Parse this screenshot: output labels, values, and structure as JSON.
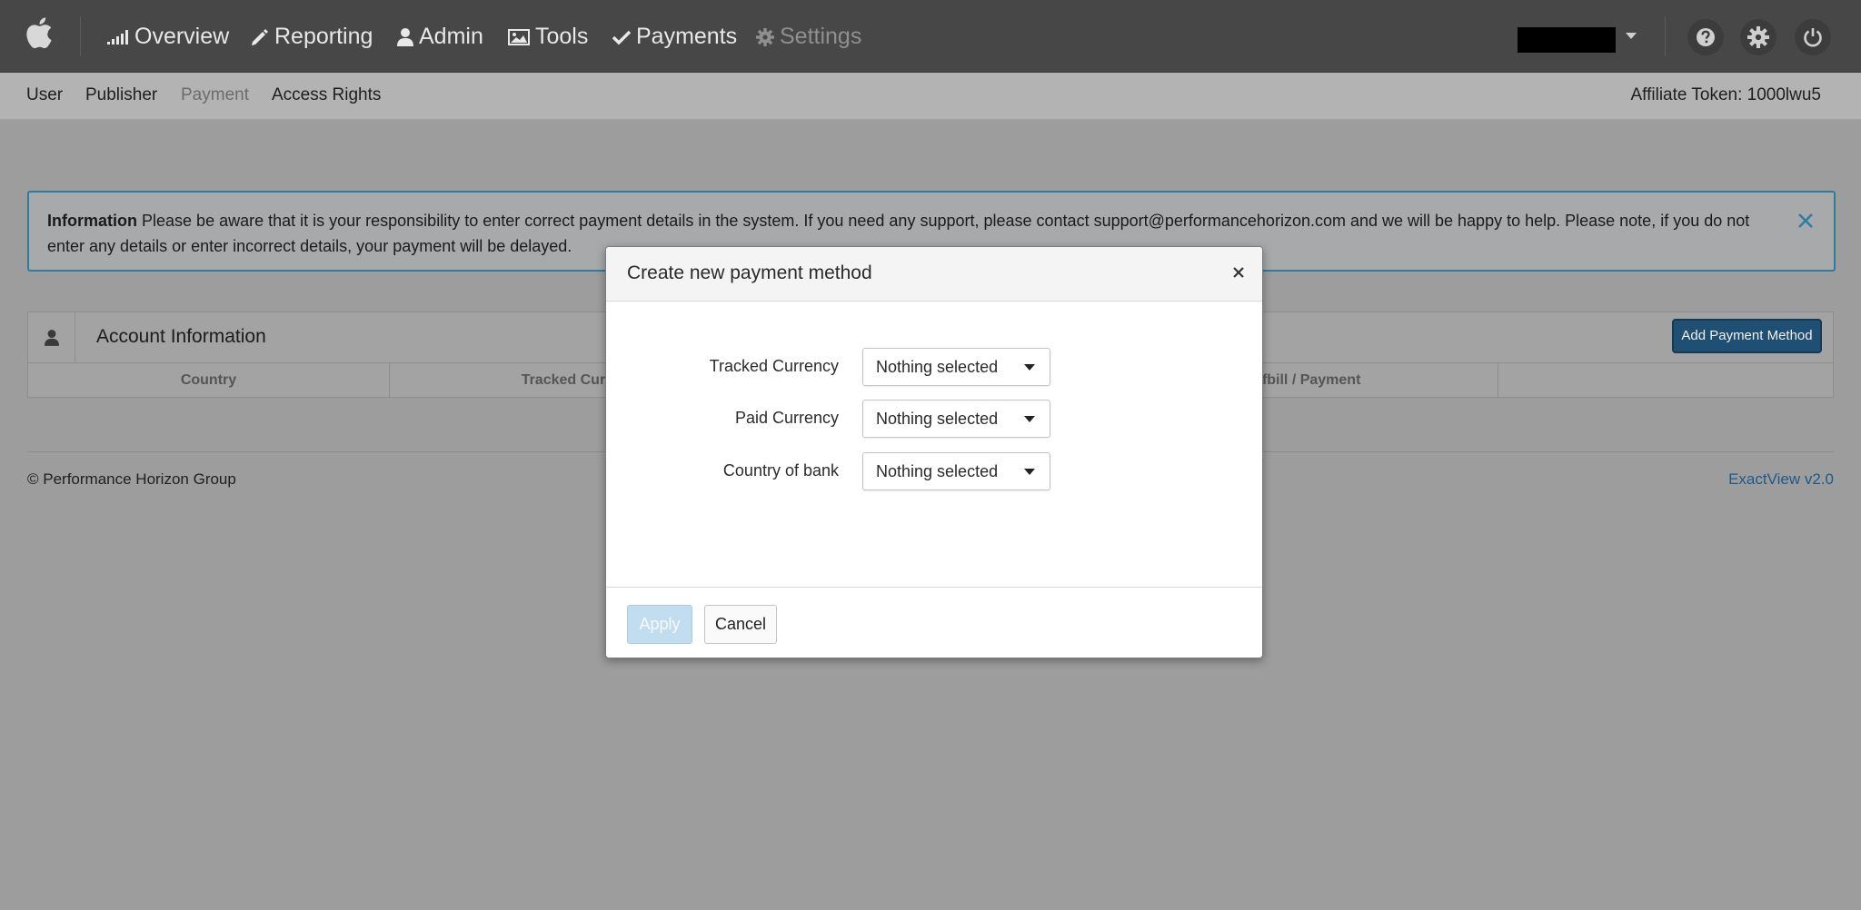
{
  "topbar": {
    "logo_icon": "apple-icon",
    "nav": [
      {
        "label": "Overview",
        "icon": "signal-bars-icon",
        "disabled": false
      },
      {
        "label": "Reporting",
        "icon": "pencil-icon",
        "disabled": false
      },
      {
        "label": "Admin",
        "icon": "user-icon",
        "disabled": false
      },
      {
        "label": "Tools",
        "icon": "picture-icon",
        "disabled": false
      },
      {
        "label": "Payments",
        "icon": "check-icon",
        "disabled": false
      },
      {
        "label": "Settings",
        "icon": "gear-icon",
        "disabled": true
      }
    ],
    "right_icons": [
      "help-icon",
      "gear-icon",
      "power-icon"
    ]
  },
  "subnav": {
    "items": [
      {
        "label": "User",
        "active": false
      },
      {
        "label": "Publisher",
        "active": false
      },
      {
        "label": "Payment",
        "active": true
      },
      {
        "label": "Access Rights",
        "active": false
      }
    ],
    "token_label": "Affiliate Token: 1000lwu5"
  },
  "alert": {
    "heading": "Information",
    "message": "Please be aware that it is your responsibility to enter correct payment details in the system. If you need any support, please contact support@performancehorizon.com and we will be happy to help. Please note, if you do not enter any details or enter incorrect details, your payment will be delayed."
  },
  "panel": {
    "title": "Account Information",
    "add_button": "Add Payment Method",
    "columns": [
      "Country",
      "Tracked Curre",
      "",
      "elfbill / Payment",
      ""
    ]
  },
  "footer": {
    "copyright": "© Performance Horizon Group",
    "version": "ExactView v2.0"
  },
  "modal": {
    "title": "Create new payment method",
    "fields": [
      {
        "label": "Tracked Currency",
        "value": "Nothing selected"
      },
      {
        "label": "Paid Currency",
        "value": "Nothing selected"
      },
      {
        "label": "Country of bank",
        "value": "Nothing selected"
      }
    ],
    "apply_label": "Apply",
    "cancel_label": "Cancel"
  },
  "colors": {
    "topbar": "#474747",
    "overlay": "#9d9d9d",
    "primary_button": "#1f4f72",
    "link": "#1d5a86",
    "apply_disabled": "#c3ddf0"
  }
}
